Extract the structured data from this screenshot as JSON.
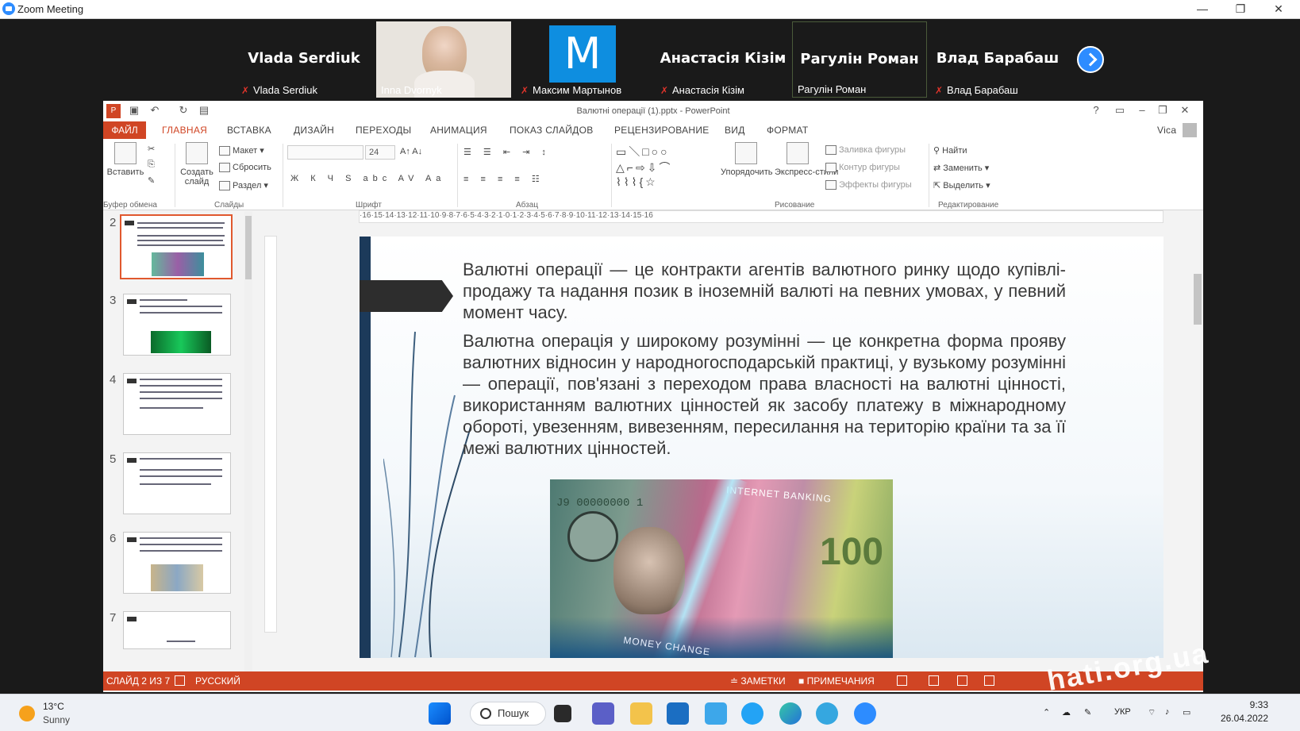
{
  "window": {
    "title": "Zoom Meeting",
    "minimize": "—",
    "maximize": "❐",
    "close": "✕"
  },
  "participants": [
    {
      "name": "Vlada Serdiuk",
      "label": "Vlada Serdiuk",
      "muted": true,
      "video": false
    },
    {
      "name": "",
      "label": "Inna Dvornyk",
      "muted": false,
      "video": true
    },
    {
      "name": "M",
      "label": "Максим Мартынов",
      "muted": true,
      "video": false
    },
    {
      "name": "Анастасія Кізім",
      "label": "Анастасія Кізім",
      "muted": true,
      "video": false
    },
    {
      "name": "Рагулін Роман",
      "label": "Рагулін Роман",
      "muted": false,
      "video": false,
      "active": true
    },
    {
      "name": "Влад Барабаш",
      "label": "Влад Барабаш",
      "muted": true,
      "video": false
    }
  ],
  "powerpoint": {
    "doc_title": "Валютні операції (1).pptx - PowerPoint",
    "user": "Vica",
    "tabs": [
      "ФАЙЛ",
      "ГЛАВНАЯ",
      "ВСТАВКА",
      "ДИЗАЙН",
      "ПЕРЕХОДЫ",
      "АНИМАЦИЯ",
      "ПОКАЗ СЛАЙДОВ",
      "РЕЦЕНЗИРОВАНИЕ",
      "ВИД",
      "ФОРМАТ"
    ],
    "ribbon": {
      "paste": "Вставить",
      "clipboard_group": "Буфер обмена",
      "new_slide": "Создать слайд",
      "layout": "Макет",
      "reset": "Сбросить",
      "section": "Раздел",
      "slides_group": "Слайды",
      "font_size": "24",
      "font_group": "Шрифт",
      "paragraph_group": "Абзац",
      "arrange": "Упорядочить",
      "quick_styles": "Экспресс-стили",
      "shape_fill": "Заливка фигуры",
      "shape_outline": "Контур фигуры",
      "shape_effects": "Эффекты фигуры",
      "drawing_group": "Рисование",
      "find": "Найти",
      "replace": "Заменить",
      "select": "Выделить",
      "editing_group": "Редактирование"
    },
    "ruler": "·16·15·14·13·12·11·10·9·8·7·6·5·4·3·2·1·0·1·2·3·4·5·6·7·8·9·10·11·12·13·14·15·16",
    "thumbnails": [
      {
        "num": "2",
        "selected": true
      },
      {
        "num": "3",
        "selected": false
      },
      {
        "num": "4",
        "selected": false
      },
      {
        "num": "5",
        "selected": false
      },
      {
        "num": "6",
        "selected": false
      },
      {
        "num": "7",
        "selected": false
      }
    ],
    "slide": {
      "paragraph1": "Валютні операції — це контракти агентів валютного ринку щодо купівлі-продажу та надання позик в іноземній валюті на певних умовах, у певний момент часу.",
      "paragraph2": "Валютна операція у широкому розумінні — це конкретна форма прояву валютних відносин у народногосподарській практиці, у вузькому розумінні — операції, пов'язані з переходом права власності на валютні цінності, використанням валютних цінностей як засобу платежу в міжнародному обороті, увезенням, вивезенням, пересилання на територію країни та за її межі валютних цінностей.",
      "image_caption_left": "MONEY CHANGE",
      "image_caption_top": "INTERNET BANKING",
      "image_banknote_value": "100",
      "image_serial": "J9 00000000 1"
    },
    "status": {
      "slide_of": "СЛАЙД 2 ИЗ 7",
      "language": "РУССКИЙ",
      "notes": "ЗАМЕТКИ",
      "comments": "ПРИМЕЧАНИЯ"
    }
  },
  "watermark": "hati.org.ua",
  "taskbar": {
    "weather_temp": "13°C",
    "weather_cond": "Sunny",
    "search": "Пошук",
    "lang": "УКР",
    "time": "9:33",
    "date": "26.04.2022"
  },
  "colors": {
    "accent": "#d04524",
    "zoom_blue": "#2d8cff",
    "slide_edge": "#1c3a5a"
  }
}
